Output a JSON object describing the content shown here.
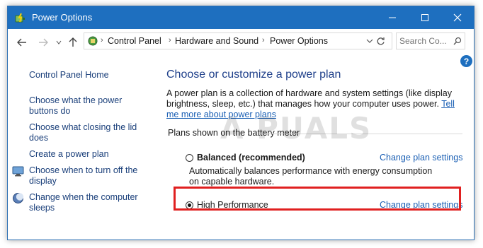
{
  "window": {
    "title": "Power Options"
  },
  "nav": {
    "breadcrumbs": [
      "Control Panel",
      "Hardware and Sound",
      "Power Options"
    ],
    "search_placeholder": "Search Co..."
  },
  "sidebar": {
    "home": "Control Panel Home",
    "links": [
      {
        "label": "Choose what the power buttons do"
      },
      {
        "label": "Choose what closing the lid does"
      },
      {
        "label": "Create a power plan"
      },
      {
        "label": "Choose when to turn off the display"
      },
      {
        "label": "Change when the computer sleeps"
      }
    ]
  },
  "main": {
    "heading": "Choose or customize a power plan",
    "description": "A power plan is a collection of hardware and system settings (like display brightness, sleep, etc.) that manages how your computer uses power.",
    "learn_more": "Tell me more about power plans",
    "plans_label": "Plans shown on the battery meter",
    "plans": [
      {
        "name": "Balanced (recommended)",
        "description": "Automatically balances performance with energy consumption on capable hardware.",
        "change_link": "Change plan settings",
        "selected": false
      },
      {
        "name": "High Performance",
        "description": "",
        "change_link": "Change plan settings",
        "selected": true
      }
    ]
  },
  "colors": {
    "titlebar": "#1e6fbf",
    "link": "#1a5fb4",
    "heading": "#1e3f8a",
    "highlight": "#e02020"
  },
  "watermark": "A PUALS"
}
